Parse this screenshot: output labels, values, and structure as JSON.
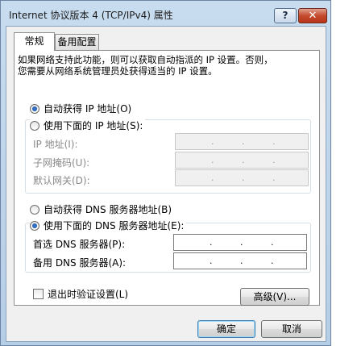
{
  "window": {
    "title": "Internet 协议版本 4 (TCP/IPv4) 属性",
    "help_label": "?",
    "close_label": "✕"
  },
  "tabs": [
    {
      "label": "常规",
      "active": true
    },
    {
      "label": "备用配置",
      "active": false
    }
  ],
  "description": "如果网络支持此功能，则可以获取自动指派的 IP 设置。否则，\n您需要从网络系统管理员处获得适当的 IP 设置。",
  "ip": {
    "auto_label": "自动获得 IP 地址(O)",
    "manual_label": "使用下面的 IP 地址(S):",
    "selected": "auto",
    "fields": [
      {
        "label": "IP 地址(I):"
      },
      {
        "label": "子网掩码(U):"
      },
      {
        "label": "默认网关(D):"
      }
    ]
  },
  "dns": {
    "auto_label": "自动获得 DNS 服务器地址(B)",
    "manual_label": "使用下面的 DNS 服务器地址(E):",
    "selected": "manual",
    "fields": [
      {
        "label": "首选 DNS 服务器(P):"
      },
      {
        "label": "备用 DNS 服务器(A):"
      }
    ]
  },
  "ip_dot": ".",
  "validate_checkbox": {
    "label": "退出时验证设置(L)",
    "checked": false
  },
  "buttons": {
    "advanced": "高级(V)...",
    "ok": "确定",
    "cancel": "取消"
  },
  "colors": {
    "titlebar": "#c8dcef",
    "close_button": "#c44b2e",
    "radio_selected": "#1a4f9c",
    "ok_button_border": "#3c7fb1"
  },
  "icons": {
    "help": "question-mark-icon",
    "close": "close-icon"
  }
}
